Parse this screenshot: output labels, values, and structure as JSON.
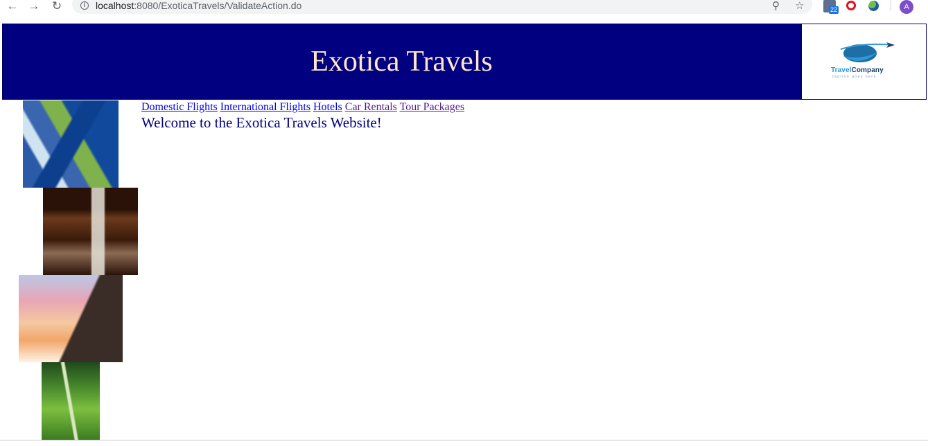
{
  "browser": {
    "url_host": "localhost",
    "url_path": ":8080/ExoticaTravels/ValidateAction.do",
    "ext_badge": "22",
    "profile_initial": "A",
    "icons": {
      "back": "arrow-left",
      "forward": "arrow-right",
      "reload": "reload",
      "info": "info-circle",
      "zoom": "magnifier",
      "bookmark": "star"
    }
  },
  "header": {
    "title": "Exotica Travels",
    "logo_text_part1": "Travel",
    "logo_text_part2": "Company",
    "logo_tagline": "tagline goes here",
    "colors": {
      "banner_bg": "#000080",
      "title_color": "#ffe6c8"
    }
  },
  "nav": {
    "links": [
      {
        "label": "Domestic Flights",
        "state": "unvisited"
      },
      {
        "label": "International Flights",
        "state": "unvisited"
      },
      {
        "label": "Hotels",
        "state": "unvisited"
      },
      {
        "label": "Car Rentals",
        "state": "visited"
      },
      {
        "label": "Tour Packages",
        "state": "visited"
      }
    ]
  },
  "main": {
    "welcome": "Welcome to the Exotica Travels Website!"
  },
  "side_images": [
    {
      "name": "mountain-river"
    },
    {
      "name": "waterfall"
    },
    {
      "name": "sunset-peak"
    },
    {
      "name": "green-valley"
    }
  ]
}
